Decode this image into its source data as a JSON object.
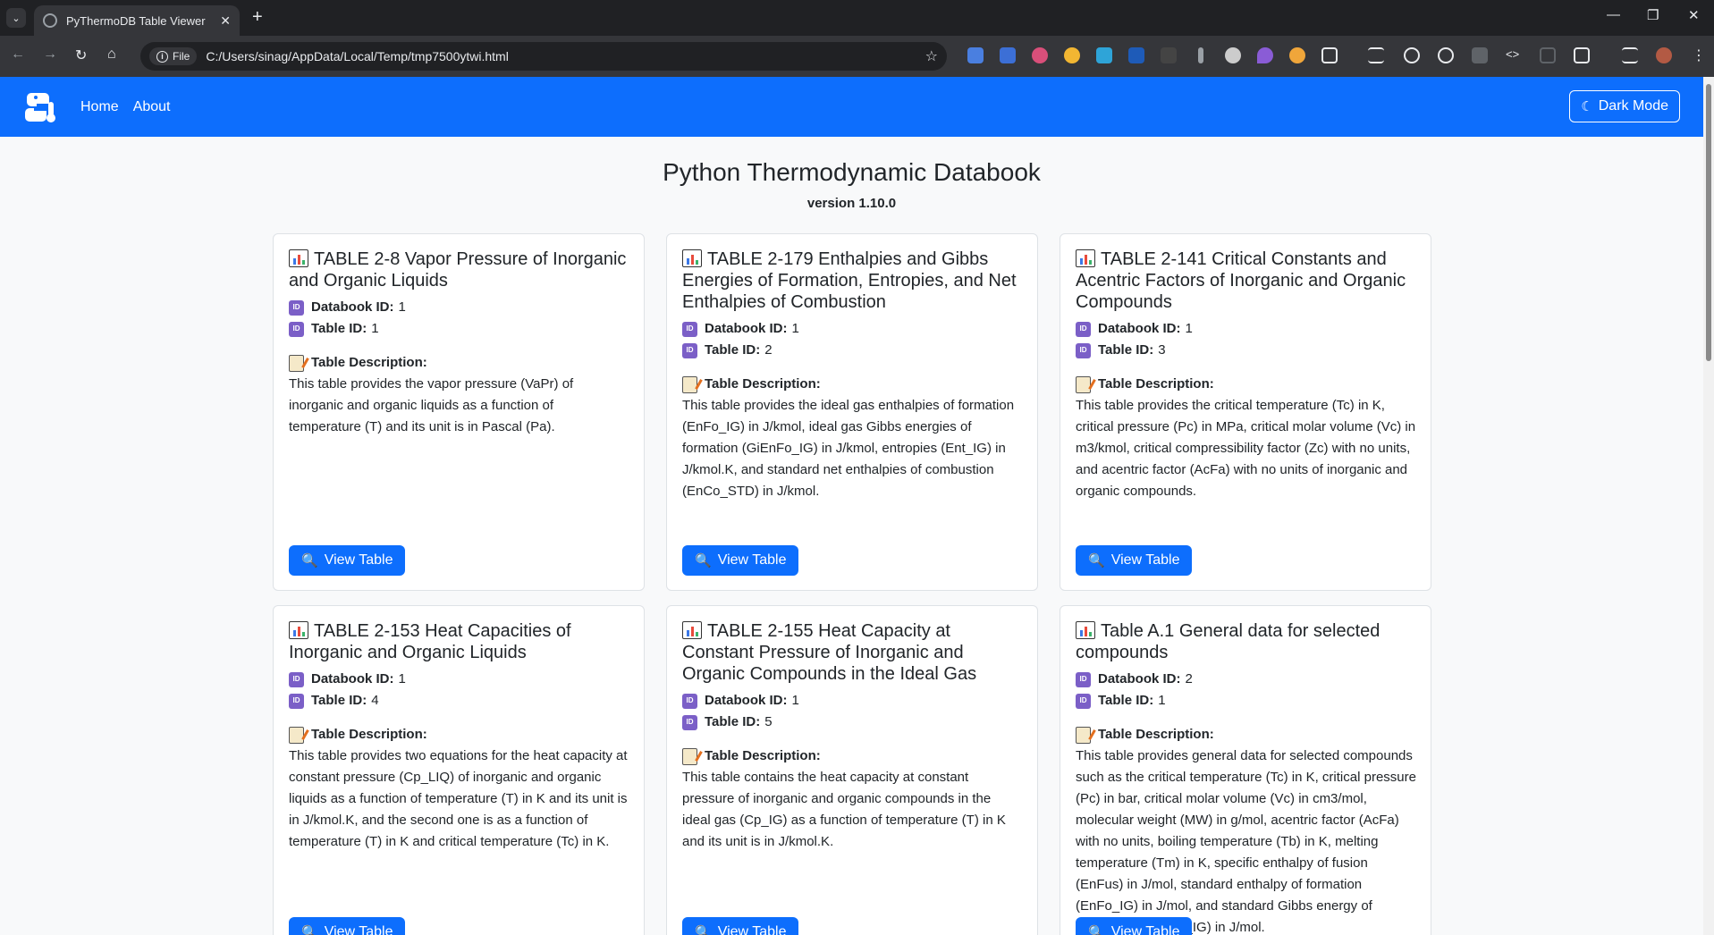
{
  "browser": {
    "tab_title": "PyThermoDB Table Viewer",
    "url_chip": "File",
    "url": "C:/Users/sinag/AppData/Local/Temp/tmp7500ytwi.html"
  },
  "navbar": {
    "links": [
      "Home",
      "About"
    ],
    "dark_mode_label": "Dark Mode"
  },
  "header": {
    "title": "Python Thermodynamic Databook",
    "version": "version 1.10.0"
  },
  "labels": {
    "databook_id": "Databook ID:",
    "table_id": "Table ID:",
    "description": "Table Description:",
    "view_button": "View Table"
  },
  "cards": [
    {
      "title": "TABLE 2-8 Vapor Pressure of Inorganic and Organic Liquids",
      "databook_id": "1",
      "table_id": "1",
      "description": "This table provides the vapor pressure (VaPr) of inorganic and organic liquids as a function of temperature (T) and its unit is in Pascal (Pa)."
    },
    {
      "title": "TABLE 2-179 Enthalpies and Gibbs Energies of Formation, Entropies, and Net Enthalpies of Combustion",
      "databook_id": "1",
      "table_id": "2",
      "description": "This table provides the ideal gas enthalpies of formation (EnFo_IG) in J/kmol, ideal gas Gibbs energies of formation (GiEnFo_IG) in J/kmol, entropies (Ent_IG) in J/kmol.K, and standard net enthalpies of combustion (EnCo_STD) in J/kmol."
    },
    {
      "title": "TABLE 2-141 Critical Constants and Acentric Factors of Inorganic and Organic Compounds",
      "databook_id": "1",
      "table_id": "3",
      "description": "This table provides the critical temperature (Tc) in K, critical pressure (Pc) in MPa, critical molar volume (Vc) in m3/kmol, critical compressibility factor (Zc) with no units, and acentric factor (AcFa) with no units of inorganic and organic compounds."
    },
    {
      "title": "TABLE 2-153 Heat Capacities of Inorganic and Organic Liquids",
      "databook_id": "1",
      "table_id": "4",
      "description": "This table provides two equations for the heat capacity at constant pressure (Cp_LIQ) of inorganic and organic liquids as a function of temperature (T) in K and its unit is in J/kmol.K, and the second one is as a function of temperature (T) in K and critical temperature (Tc) in K."
    },
    {
      "title": "TABLE 2-155 Heat Capacity at Constant Pressure of Inorganic and Organic Compounds in the Ideal Gas",
      "databook_id": "1",
      "table_id": "5",
      "description": "This table contains the heat capacity at constant pressure of inorganic and organic compounds in the ideal gas (Cp_IG) as a function of temperature (T) in K and its unit is in J/kmol.K."
    },
    {
      "title": "Table A.1 General data for selected compounds",
      "databook_id": "2",
      "table_id": "1",
      "description": "This table provides general data for selected compounds such as the critical temperature (Tc) in K, critical pressure (Pc) in bar, critical molar volume (Vc) in cm3/mol, molecular weight (MW) in g/mol, acentric factor (AcFa) with no units, boiling temperature (Tb) in K, melting temperature (Tm) in K, specific enthalpy of fusion (EnFus) in J/mol, standard enthalpy of formation (EnFo_IG) in J/mol, and standard Gibbs energy of formation (GiEnFo_IG) in J/mol."
    }
  ]
}
